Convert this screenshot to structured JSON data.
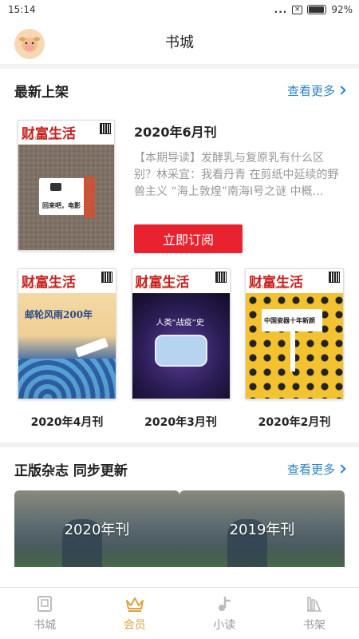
{
  "status": {
    "time": "15:14",
    "dots": "...",
    "battery": "92%",
    "battery_level": 0.92
  },
  "header": {
    "title": "书城"
  },
  "newest": {
    "section_title": "最新上架",
    "more_label": "查看更多",
    "featured": {
      "cover_masthead": "财富生活",
      "cover_subtitle": "FORTUNE LIFE",
      "cover_headline": "回来吧，电影",
      "issue": "2020年6月刊",
      "description": "【本期导读】发酵乳与复原乳有什么区别？林采宜：我看丹青 在剪纸中延续的野兽主义 “海上敦煌”南海I号之谜 中概…",
      "subscribe_label": "立即订阅"
    },
    "grid": [
      {
        "masthead": "财富生活",
        "subtitle": "FORTUNE LIFE",
        "headline": "邮轮风雨200年",
        "issue": "2020年4月刊"
      },
      {
        "masthead": "财富生活",
        "subtitle": "FORTUNE LIFE",
        "headline": "人类“战疫”史",
        "issue": "2020年3月刊"
      },
      {
        "masthead": "财富生活",
        "subtitle": "FORTUNE LIFE",
        "headline": "中国瓷器十年新颜",
        "issue": "2020年2月刊"
      }
    ]
  },
  "genuine": {
    "section_title": "正版杂志 同步更新",
    "more_label": "查看更多",
    "banners": [
      {
        "label": "2020年刊"
      },
      {
        "label": "2019年刊"
      }
    ]
  },
  "tabbar": [
    {
      "label": "书城",
      "icon": "book-icon",
      "active": false
    },
    {
      "label": "会员",
      "icon": "crown-icon",
      "active": true
    },
    {
      "label": "小读",
      "icon": "music-note-icon",
      "active": false
    },
    {
      "label": "书架",
      "icon": "bookshelf-icon",
      "active": false
    }
  ],
  "colors": {
    "accent_red": "#e8222e",
    "link_blue": "#2a85c6",
    "active_gold": "#d9a441"
  }
}
